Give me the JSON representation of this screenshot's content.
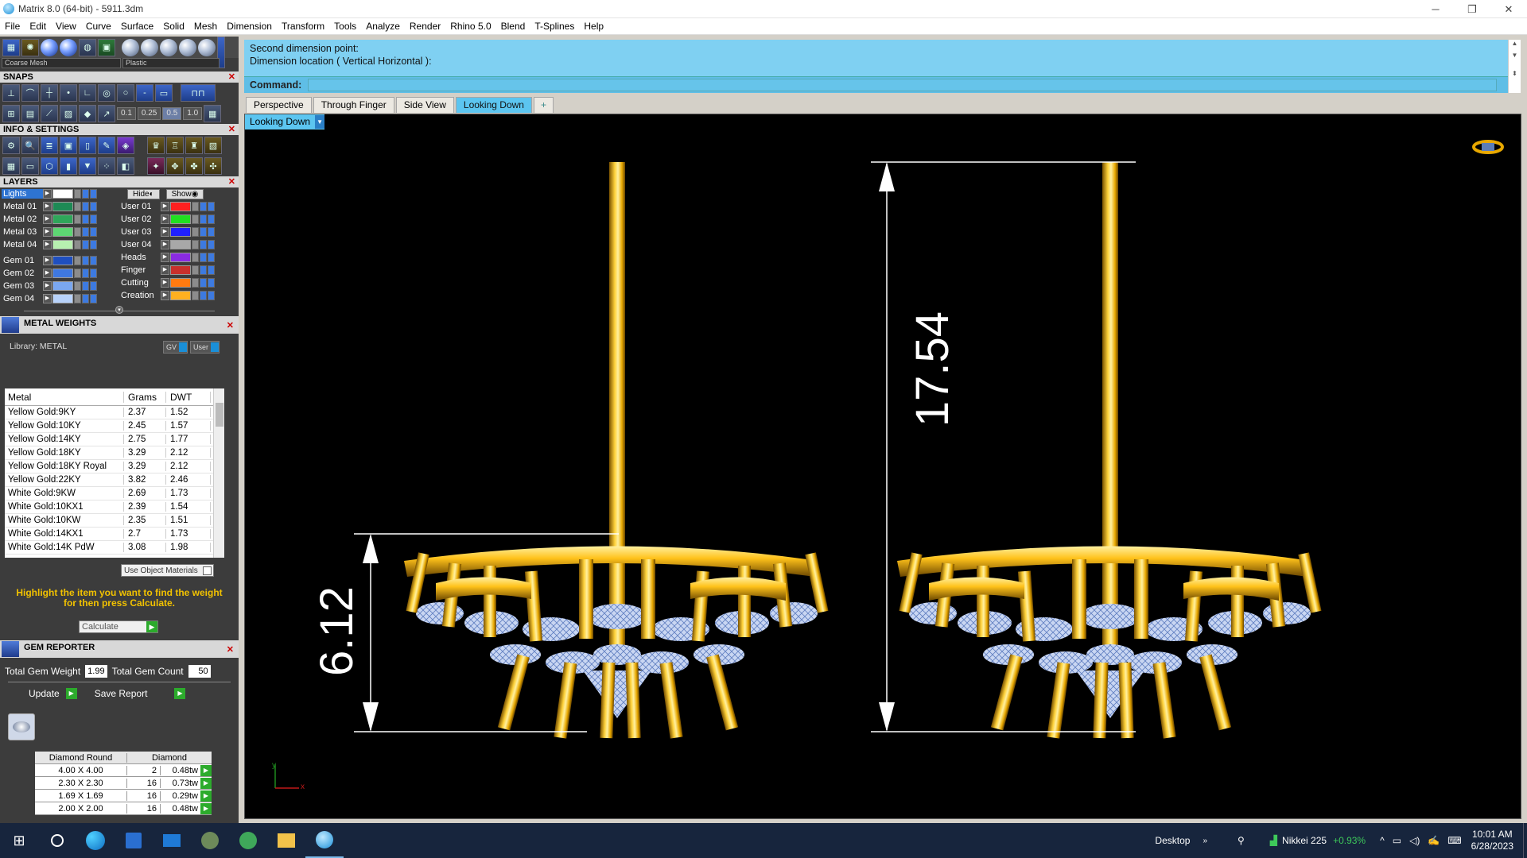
{
  "window": {
    "title": "Matrix 8.0 (64-bit) - 5911.3dm",
    "controls": [
      "─",
      "❐",
      "✕"
    ]
  },
  "menu": [
    "File",
    "Edit",
    "View",
    "Curve",
    "Surface",
    "Solid",
    "Mesh",
    "Dimension",
    "Transform",
    "Tools",
    "Analyze",
    "Render",
    "Rhino 5.0",
    "Blend",
    "T-Splines",
    "Help"
  ],
  "toolbar": {
    "mesh_dropdown": "Coarse Mesh",
    "material_dropdown": "Plastic"
  },
  "snaps": {
    "title": "SNAPS",
    "values": [
      "0.1",
      "0.25",
      "0.5",
      "1.0"
    ]
  },
  "info": {
    "title": "INFO & SETTINGS"
  },
  "layers": {
    "title": "LAYERS",
    "hide_label": "Hide",
    "show_label": "Show",
    "left": [
      {
        "name": "Lights",
        "color": "#ffffff",
        "selected": true
      },
      {
        "name": "Metal 01",
        "color": "#1d8a55"
      },
      {
        "name": "Metal 02",
        "color": "#2fa65a"
      },
      {
        "name": "Metal 03",
        "color": "#5dd673"
      },
      {
        "name": "Metal 04",
        "color": "#b7f0b0"
      },
      {
        "name": "Gem 01",
        "color": "#1f4fbf"
      },
      {
        "name": "Gem 02",
        "color": "#3f78e0"
      },
      {
        "name": "Gem 03",
        "color": "#7aa7f0"
      },
      {
        "name": "Gem 04",
        "color": "#b8d2fa"
      }
    ],
    "right": [
      {
        "name": "User 01",
        "color": "#ff2020"
      },
      {
        "name": "User 02",
        "color": "#20e020"
      },
      {
        "name": "User 03",
        "color": "#2020ff"
      },
      {
        "name": "User 04",
        "color": "#a8a8a8"
      },
      {
        "name": "Heads",
        "color": "#8a2be2"
      },
      {
        "name": "Finger",
        "color": "#c8302c"
      },
      {
        "name": "Cutting",
        "color": "#ff7a10"
      },
      {
        "name": "Creation",
        "color": "#ffb020"
      }
    ]
  },
  "metal_weights": {
    "title": "METAL WEIGHTS",
    "library": "Library: METAL",
    "gv": "GV",
    "user": "User",
    "columns": [
      "Metal",
      "Grams",
      "DWT"
    ],
    "rows": [
      [
        "Yellow Gold:9KY",
        "2.37",
        "1.52"
      ],
      [
        "Yellow Gold:10KY",
        "2.45",
        "1.57"
      ],
      [
        "Yellow Gold:14KY",
        "2.75",
        "1.77"
      ],
      [
        "Yellow Gold:18KY",
        "3.29",
        "2.12"
      ],
      [
        "Yellow Gold:18KY Royal",
        "3.29",
        "2.12"
      ],
      [
        "Yellow Gold:22KY",
        "3.82",
        "2.46"
      ],
      [
        "White Gold:9KW",
        "2.69",
        "1.73"
      ],
      [
        "White Gold:10KX1",
        "2.39",
        "1.54"
      ],
      [
        "White Gold:10KW",
        "2.35",
        "1.51"
      ],
      [
        "White Gold:14KX1",
        "2.7",
        "1.73"
      ],
      [
        "White Gold:14K PdW",
        "3.08",
        "1.98"
      ]
    ],
    "use_object_materials": "Use Object Materials",
    "instruction": "Highlight the item you want to find the weight for then press Calculate.",
    "calculate": "Calculate"
  },
  "gem_reporter": {
    "title": "GEM REPORTER",
    "total_weight_label": "Total Gem Weight",
    "total_weight": "1.99",
    "total_count_label": "Total Gem Count",
    "total_count": "50",
    "update": "Update",
    "save_report": "Save Report",
    "columns": [
      "Diamond Round",
      "Diamond"
    ],
    "rows": [
      [
        "4.00 X 4.00",
        "2",
        "0.48tw"
      ],
      [
        "2.30 X 2.30",
        "16",
        "0.73tw"
      ],
      [
        "1.69 X 1.69",
        "16",
        "0.29tw"
      ],
      [
        "2.00 X 2.00",
        "16",
        "0.48tw"
      ]
    ]
  },
  "command": {
    "history": [
      "Second dimension point:",
      "Dimension location ( Vertical  Horizontal ):"
    ],
    "label": "Command:"
  },
  "tabs": [
    "Perspective",
    "Through Finger",
    "Side View",
    "Looking Down",
    "+"
  ],
  "active_tab": "Looking Down",
  "viewport": {
    "label": "Looking Down",
    "dim_large": "17.54",
    "dim_small": "6.12",
    "axis_y": "y",
    "axis_x": "x"
  },
  "taskbar": {
    "desktop": "Desktop",
    "stock_name": "Nikkei 225",
    "stock_change": "+0.93%",
    "time": "10:01 AM",
    "date": "6/28/2023"
  }
}
